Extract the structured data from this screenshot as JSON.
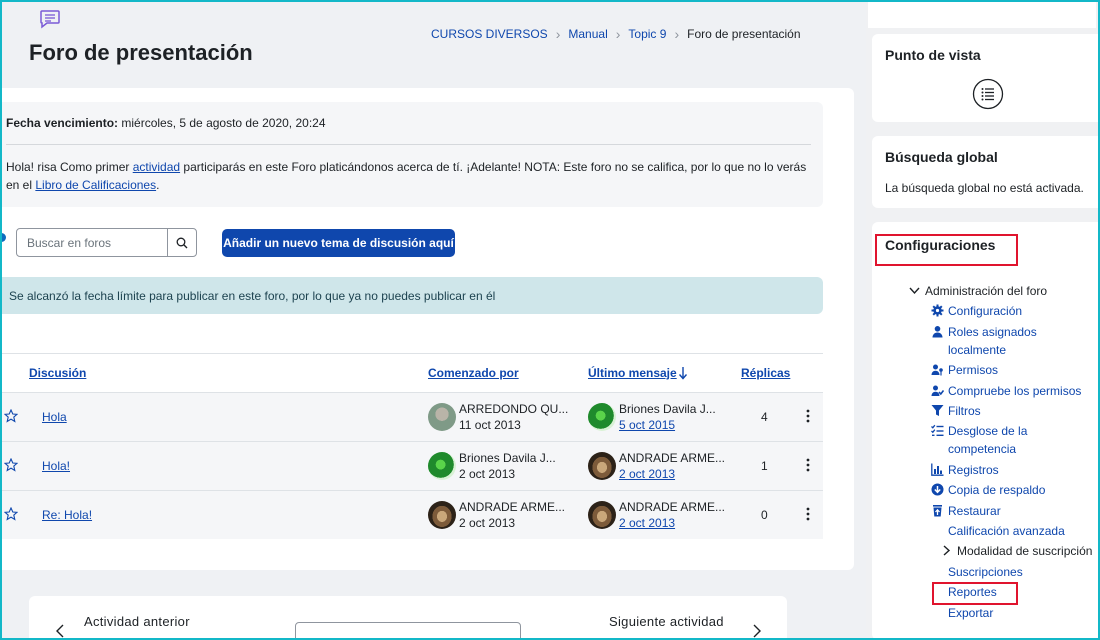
{
  "page": {
    "title": "Foro de presentación",
    "forum_icon": "forum-chat-icon"
  },
  "breadcrumb": {
    "items": [
      "CURSOS DIVERSOS",
      "Manual",
      "Topic 9"
    ],
    "current": "Foro de presentación"
  },
  "info": {
    "due_label": "Fecha vencimiento:",
    "due_value": " miércoles, 5 de agosto de 2020, 20:24",
    "intro_part1": "Hola! risa Como primer ",
    "intro_link1": "actividad",
    "intro_part2": " participarás en este Foro platicándonos acerca de tí. ¡Adelante! NOTA: Este foro no se califica, por lo que no lo verás en el ",
    "intro_link2": "Libro de Calificaciones",
    "intro_part3": "."
  },
  "search": {
    "placeholder": "Buscar en foros",
    "icon": "search-icon"
  },
  "add_topic_label": "Añadir un nuevo tema de discusión aquí",
  "alert_text": "Se alcanzó la fecha límite para publicar en este foro, por lo que ya no puedes publicar en él",
  "table": {
    "headers": {
      "discussion": "Discusión",
      "started_by": "Comenzado por",
      "last_post": "Último mensaje",
      "replies": "Réplicas"
    },
    "rows": [
      {
        "title": "Hola",
        "started_name": "ARREDONDO QU...",
        "started_date": "11 oct 2013",
        "started_avatar": "avatar-a",
        "last_name": "Briones Davila J...",
        "last_date": "5 oct 2015",
        "last_avatar": "avatar-b",
        "replies": "4"
      },
      {
        "title": "Hola!",
        "started_name": "Briones Davila J...",
        "started_date": "2 oct 2013",
        "started_avatar": "avatar-b",
        "last_name": "ANDRADE ARME...",
        "last_date": "2 oct 2013",
        "last_avatar": "avatar-m",
        "replies": "1"
      },
      {
        "title": "Re: Hola!",
        "started_name": "ANDRADE ARME...",
        "started_date": "2 oct 2013",
        "started_avatar": "avatar-m",
        "last_name": "ANDRADE ARME...",
        "last_date": "2 oct 2013",
        "last_avatar": "avatar-m",
        "replies": "0"
      }
    ]
  },
  "activity_nav": {
    "prev_label": "Actividad anterior",
    "next_label": "Siguiente actividad"
  },
  "sidebar": {
    "view_block": {
      "title": "Punto de vista",
      "icon": "list-view-icon"
    },
    "search_block": {
      "title": "Búsqueda global",
      "text": "La búsqueda global no está activada."
    },
    "settings_block": {
      "title": "Configuraciones",
      "root": "Administración del foro",
      "items": [
        {
          "label": "Configuración",
          "icon": "gear-icon"
        },
        {
          "label": "Roles asignados localmente",
          "icon": "user-icon"
        },
        {
          "label": "Permisos",
          "icon": "users-key-icon"
        },
        {
          "label": "Compruebe los permisos",
          "icon": "users-check-icon"
        },
        {
          "label": "Filtros",
          "icon": "filter-icon"
        },
        {
          "label": "Desglose de la competencia",
          "icon": "checklist-icon"
        },
        {
          "label": "Registros",
          "icon": "bar-chart-icon"
        },
        {
          "label": "Copia de respaldo",
          "icon": "download-icon"
        },
        {
          "label": "Restaurar",
          "icon": "trash-restore-icon"
        },
        {
          "label": "Calificación avanzada",
          "icon": ""
        },
        {
          "label": "Modalidad de suscripción",
          "icon": "chevron-right-icon"
        },
        {
          "label": "Suscripciones",
          "icon": ""
        },
        {
          "label": "Reportes",
          "icon": ""
        },
        {
          "label": "Exportar",
          "icon": ""
        }
      ]
    }
  },
  "colors": {
    "primary": "#0f47ad",
    "alert_bg": "#cfe6ea",
    "highlight_red": "#e0142e",
    "frame": "#13b8c8"
  }
}
